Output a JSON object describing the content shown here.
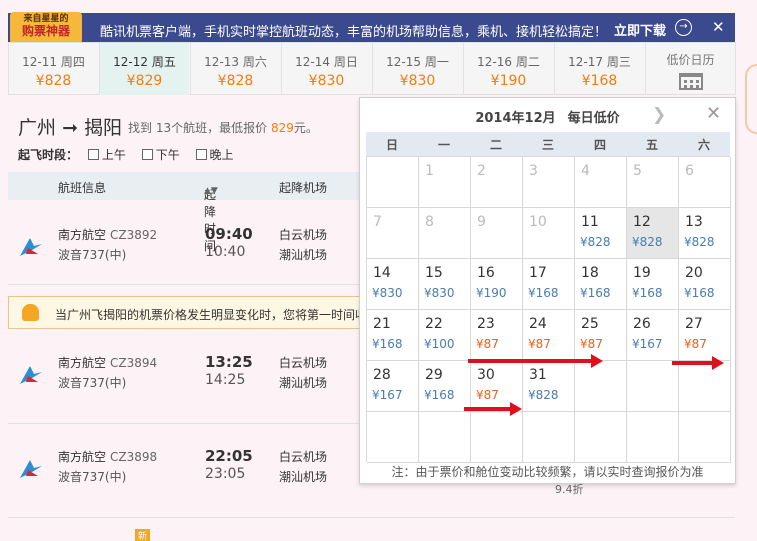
{
  "banner": {
    "badge_top": "来自星星的",
    "badge_main": "购票神器",
    "text": "酷讯机票客户端，手机实时掌控航班动态，丰富的机场帮助信息，乘机、接机轻松搞定！",
    "download": "立即下载",
    "close": "✕",
    "download_icon": "→"
  },
  "tabs": [
    {
      "date": "12-11 周四",
      "price": "¥828"
    },
    {
      "date": "12-12 周五",
      "price": "¥829"
    },
    {
      "date": "12-13 周六",
      "price": "¥828"
    },
    {
      "date": "12-14 周日",
      "price": "¥830"
    },
    {
      "date": "12-15 周一",
      "price": "¥830"
    },
    {
      "date": "12-16 周二",
      "price": "¥190"
    },
    {
      "date": "12-17 周三",
      "price": "¥168"
    }
  ],
  "calendar_tab": {
    "label": "低价日历",
    "icon": "calendar-icon"
  },
  "route": {
    "from": "广州",
    "arrow": "➞",
    "to": "揭阳",
    "found_prefix": "找到",
    "count": "13",
    "found_mid": "个航班，最低报价",
    "lowest": "829",
    "found_suffix": "元。"
  },
  "filter": {
    "label": "起飞时段：",
    "options": [
      "上午",
      "下午",
      "晚上"
    ]
  },
  "list_header": {
    "info": "航班信息",
    "time": "起降时间",
    "sort_icon": "▲▼",
    "airport": "起降机场"
  },
  "flights": [
    {
      "airline": "南方航空",
      "number": "CZ3892",
      "plane": "波音737(中)",
      "dep": "09:40",
      "arr": "10:40",
      "from": "白云机场",
      "to": "潮汕机场"
    },
    {
      "airline": "南方航空",
      "number": "CZ3894",
      "plane": "波音737(中)",
      "dep": "13:25",
      "arr": "14:25",
      "from": "白云机场",
      "to": "潮汕机场"
    },
    {
      "airline": "南方航空",
      "number": "CZ3898",
      "plane": "波音737(中)",
      "dep": "22:05",
      "arr": "23:05",
      "from": "白云机场",
      "to": "潮汕机场"
    }
  ],
  "alert": {
    "text": "当广州飞揭阳的机票价格发生明显变化时，您将第一时间收到通知"
  },
  "discount": "9.4折",
  "new_tag": "新",
  "calendar": {
    "year_month": "2014年12月",
    "title": "每日低价",
    "next": "❯",
    "close": "✕",
    "weekdays": [
      "日",
      "一",
      "二",
      "三",
      "四",
      "五",
      "六"
    ],
    "cells": [
      {
        "day": "",
        "price": ""
      },
      {
        "day": "1",
        "price": ""
      },
      {
        "day": "2",
        "price": ""
      },
      {
        "day": "3",
        "price": ""
      },
      {
        "day": "4",
        "price": ""
      },
      {
        "day": "5",
        "price": ""
      },
      {
        "day": "6",
        "price": ""
      },
      {
        "day": "7",
        "price": ""
      },
      {
        "day": "8",
        "price": ""
      },
      {
        "day": "9",
        "price": ""
      },
      {
        "day": "10",
        "price": ""
      },
      {
        "day": "11",
        "price": "¥828"
      },
      {
        "day": "12",
        "price": "¥828"
      },
      {
        "day": "13",
        "price": "¥828"
      },
      {
        "day": "14",
        "price": "¥830"
      },
      {
        "day": "15",
        "price": "¥830"
      },
      {
        "day": "16",
        "price": "¥190"
      },
      {
        "day": "17",
        "price": "¥168"
      },
      {
        "day": "18",
        "price": "¥168"
      },
      {
        "day": "19",
        "price": "¥168"
      },
      {
        "day": "20",
        "price": "¥168"
      },
      {
        "day": "21",
        "price": "¥168"
      },
      {
        "day": "22",
        "price": "¥100"
      },
      {
        "day": "23",
        "price": "¥87"
      },
      {
        "day": "24",
        "price": "¥87"
      },
      {
        "day": "25",
        "price": "¥87"
      },
      {
        "day": "26",
        "price": "¥167"
      },
      {
        "day": "27",
        "price": "¥87"
      },
      {
        "day": "28",
        "price": "¥167"
      },
      {
        "day": "29",
        "price": "¥168"
      },
      {
        "day": "30",
        "price": "¥87"
      },
      {
        "day": "31",
        "price": "¥828"
      },
      {
        "day": "",
        "price": ""
      },
      {
        "day": "",
        "price": ""
      },
      {
        "day": "",
        "price": ""
      },
      {
        "day": "",
        "price": ""
      },
      {
        "day": "",
        "price": ""
      },
      {
        "day": "",
        "price": ""
      },
      {
        "day": "",
        "price": ""
      },
      {
        "day": "",
        "price": ""
      },
      {
        "day": "",
        "price": ""
      },
      {
        "day": "",
        "price": ""
      }
    ],
    "note": "注：由于票价和舱位变动比较频繁，请以实时查询报价为准"
  },
  "colors": {
    "accent_price": "#f17d0a",
    "low_price": "#e8631c",
    "normal_price": "#4a7cb0",
    "arrow": "#e0101a",
    "banner": "#3b4a8f"
  }
}
